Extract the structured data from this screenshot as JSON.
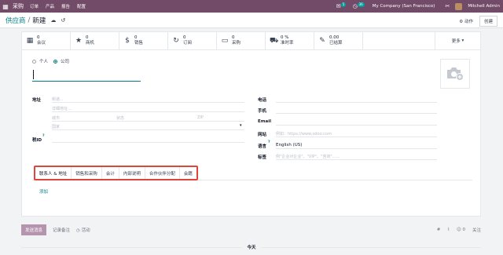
{
  "nav": {
    "brand": "采购",
    "menus": [
      "订单",
      "产品",
      "报告",
      "配置"
    ],
    "messages_badge": "5",
    "activities_badge": "36",
    "company": "My Company (San Francisco)",
    "user": "Mitchell Admin"
  },
  "control": {
    "parent": "供应商",
    "current": "新建",
    "action_label": "动作",
    "new_label": "创建"
  },
  "stats": [
    {
      "icon": "calendar-icon",
      "glyph": "▦",
      "value": "0",
      "label": "会议"
    },
    {
      "icon": "star-icon",
      "glyph": "★",
      "value": "0",
      "label": "商机"
    },
    {
      "icon": "dollar-icon",
      "glyph": "$",
      "value": "0",
      "label": "销售"
    },
    {
      "icon": "refresh-icon",
      "glyph": "↻",
      "value": "0",
      "label": "订阅"
    },
    {
      "icon": "credit-card-icon",
      "glyph": "▭",
      "value": "0",
      "label": "采购"
    },
    {
      "icon": "truck-icon",
      "glyph": "⛟",
      "value": "0 %",
      "label": "准时率"
    },
    {
      "icon": "edit-icon",
      "glyph": "✎",
      "value": "0.00",
      "label": "已结算"
    }
  ],
  "more_label": "更多",
  "type_options": {
    "individual": "个人",
    "company": "公司"
  },
  "address": {
    "label": "地址",
    "street_ph": "街道...",
    "street2_ph": "详细地址...",
    "city_ph": "城市",
    "state_ph": "状态",
    "zip_ph": "ZIP",
    "country_ph": "国家"
  },
  "tax": {
    "label": "税ID",
    "sup": "?"
  },
  "right_fields": {
    "phone": "电话",
    "mobile": "手机",
    "email": "Email",
    "website": "网站",
    "website_ph": "例如：https://www.odoo.com",
    "language": "语言",
    "language_sup": "?",
    "language_value": "English (US)",
    "tags": "标签",
    "tags_ph": "例\"企业对企业\"、\"VIP\"、\"咨询\"......"
  },
  "tabs": [
    "联系人 & 地址",
    "销售和采购",
    "会计",
    "内部说明",
    "合作伙伴分配",
    "会籍"
  ],
  "add_label": "添加",
  "chatter": {
    "send": "发送消息",
    "note": "记录备注",
    "activity": "活动",
    "follow": "关注",
    "followers": "0",
    "attachments": "",
    "today": "今天"
  },
  "colors": {
    "brand": "#714b67",
    "accent": "#017e84",
    "highlight": "#e0453a"
  }
}
